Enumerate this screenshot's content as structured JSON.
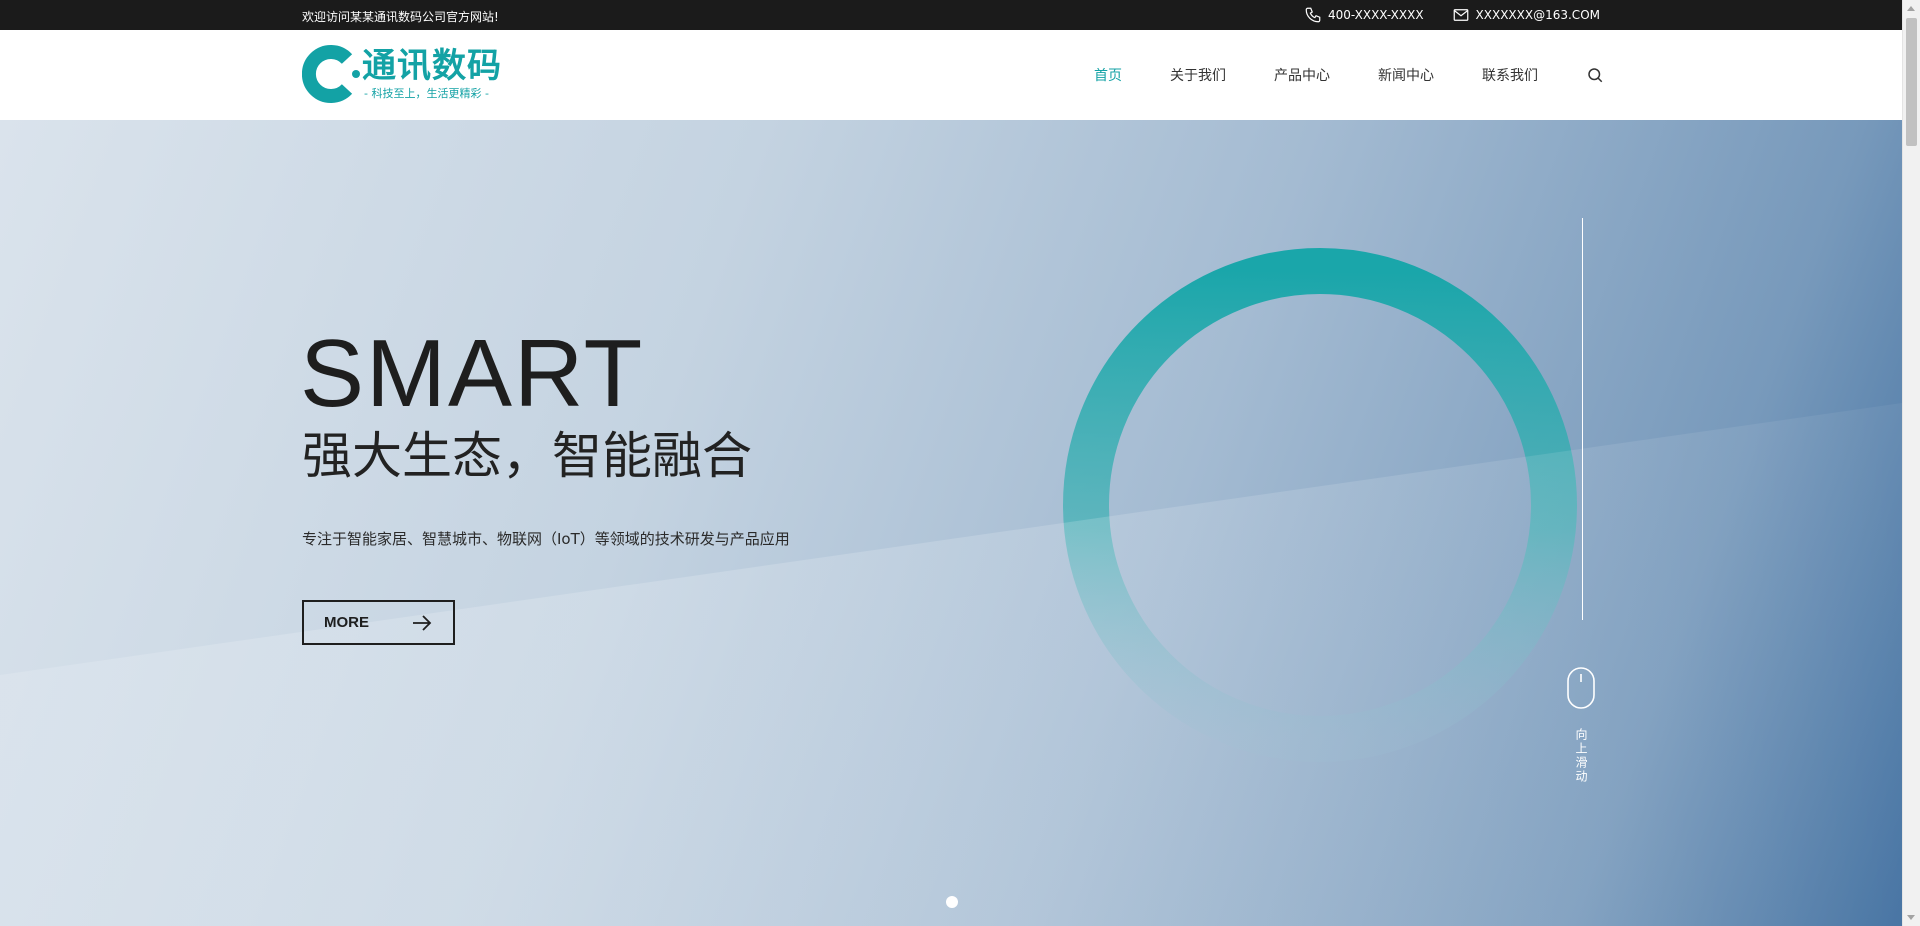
{
  "topbar": {
    "welcome": "欢迎访问某某通讯数码公司官方网站!",
    "phone": "400-XXXX-XXXX",
    "email": "XXXXXXX@163.COM"
  },
  "header": {
    "logo_title": "通讯数码",
    "logo_slogan": "- 科技至上，生活更精彩 -",
    "nav": [
      "首页",
      "关于我们",
      "产品中心",
      "新闻中心",
      "联系我们"
    ],
    "active_nav": "首页"
  },
  "hero": {
    "title": "SMART",
    "subtitle": "强大生态，智能融合",
    "description": "专注于智能家居、智慧城市、物联网（IoT）等领域的技术研发与产品应用",
    "more_label": "MORE",
    "scroll_hint": "向上滑动"
  },
  "colors": {
    "accent": "#13a2a5",
    "topbar_bg": "#1b1b1b",
    "text_dark": "#1e1e1e"
  },
  "icons": [
    "phone-icon",
    "mail-icon",
    "search-icon",
    "arrow-right-icon",
    "mouse-icon",
    "logo-c-icon"
  ]
}
